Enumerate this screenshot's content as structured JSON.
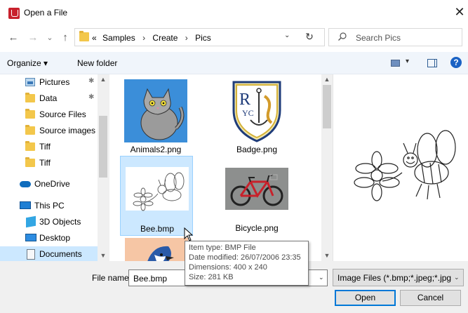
{
  "window": {
    "title": "Open a File",
    "close_glyph": "✕"
  },
  "nav": {
    "back_glyph": "←",
    "forward_glyph": "→",
    "recent_glyph": "⌄",
    "up_glyph": "↑",
    "breadcrumb_overflow": "«",
    "breadcrumbs": [
      "Samples",
      "Create",
      "Pics"
    ],
    "separator": "›",
    "dropdown_glyph": "⌄",
    "refresh_glyph": "↻",
    "search_placeholder": "Search Pics"
  },
  "toolbar": {
    "organize_label": "Organize ▾",
    "new_folder_label": "New folder",
    "view_dropdown_glyph": "▾",
    "help_glyph": "?"
  },
  "sidebar": {
    "items": [
      {
        "label": "Pictures",
        "icon": "pictures-icon",
        "pinned": true
      },
      {
        "label": "Data",
        "icon": "folder-icon",
        "pinned": true
      },
      {
        "label": "Source Files",
        "icon": "folder-icon",
        "pinned": false
      },
      {
        "label": "Source images",
        "icon": "folder-icon",
        "pinned": false
      },
      {
        "label": "Tiff",
        "icon": "folder-icon",
        "pinned": false
      },
      {
        "label": "Tiff",
        "icon": "folder-icon",
        "pinned": false
      },
      {
        "label": "OneDrive",
        "icon": "onedrive-icon",
        "pinned": false
      },
      {
        "label": "This PC",
        "icon": "this-pc-icon",
        "pinned": false
      },
      {
        "label": "3D Objects",
        "icon": "3d-objects-icon",
        "pinned": false
      },
      {
        "label": "Desktop",
        "icon": "desktop-icon",
        "pinned": false
      },
      {
        "label": "Documents",
        "icon": "documents-icon",
        "pinned": false,
        "selected": true
      }
    ],
    "pin_glyph": "📌"
  },
  "files": [
    {
      "name": "Animals2.png",
      "thumbnail": "cat-thumbnail"
    },
    {
      "name": "Badge.png",
      "thumbnail": "badge-thumbnail"
    },
    {
      "name": "Bee.bmp",
      "thumbnail": "bee-thumbnail",
      "selected": true
    },
    {
      "name": "Bicycle.png",
      "thumbnail": "bicycle-thumbnail"
    },
    {
      "name": "",
      "thumbnail": "bird-thumbnail"
    }
  ],
  "tooltip": {
    "type": "Item type: BMP File",
    "modified": "Date modified: 26/07/2006 23:35",
    "dimensions": "Dimensions: 400 x 240",
    "size": "Size: 281 KB"
  },
  "bottom": {
    "file_name_label": "File name:",
    "file_name_value": "Bee.bmp",
    "filter_value": "Image Files (*.bmp;*.jpeg;*.jpg;",
    "dropdown_glyph": "⌄",
    "open_label": "Open",
    "cancel_label": "Cancel"
  },
  "colors": {
    "selection": "#cce8ff",
    "toolbar_bg": "#f0f5fb",
    "bottom_bg": "#f0f0f0",
    "accent": "#0078d7"
  }
}
